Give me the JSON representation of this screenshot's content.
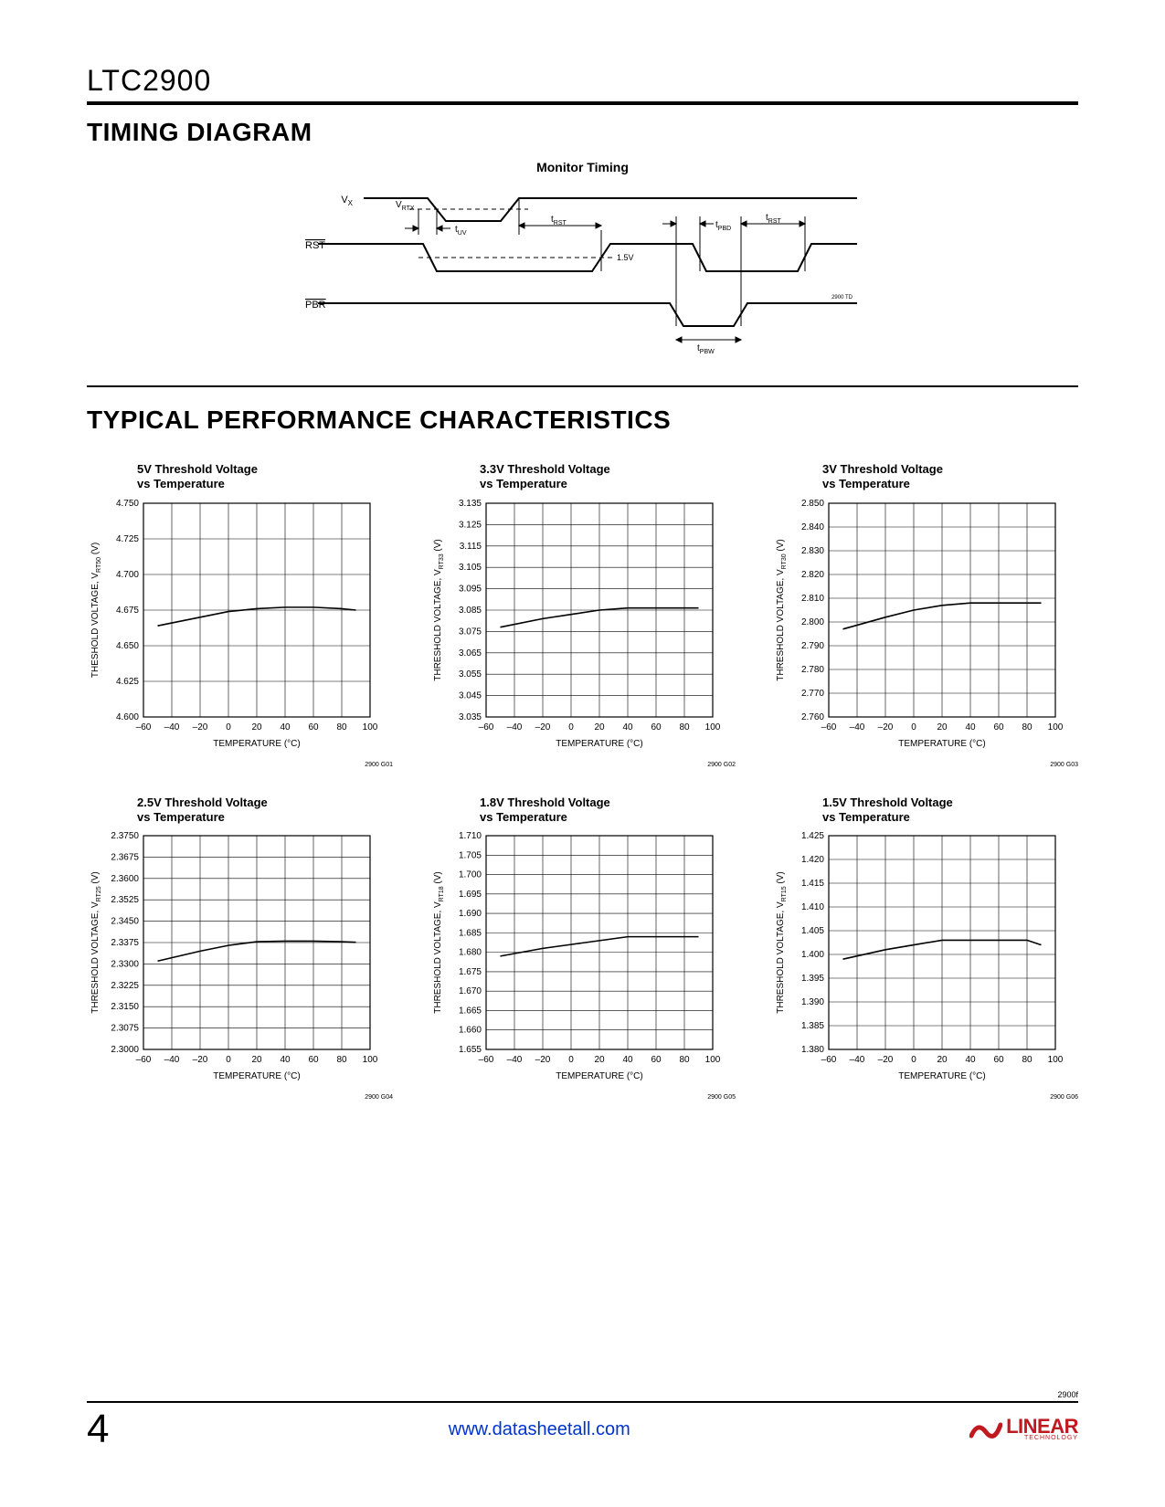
{
  "header": {
    "part_number": "LTC2900"
  },
  "sections": {
    "timing_heading": "TIMING DIAGRAM",
    "perf_heading": "TYPICAL PERFORMANCE CHARACTERISTICS"
  },
  "timing": {
    "title": "Monitor Timing",
    "signals": {
      "vx": "V",
      "vx_sub": "X",
      "rst": "RST",
      "pbr": "PBR"
    },
    "labels": {
      "vrtx": "V",
      "vrtx_sub": "RTX",
      "tuv": "t",
      "tuv_sub": "UV",
      "trst": "t",
      "trst_sub": "RST",
      "tpbd": "t",
      "tpbd_sub": "PBD",
      "trst2": "t",
      "trst2_sub": "RST",
      "tpbw": "t",
      "tpbw_sub": "PBW",
      "v15": "1.5V"
    },
    "code": "2900 TD"
  },
  "chart_data": [
    {
      "type": "line",
      "title": "5V Threshold Voltage\nvs Temperature",
      "xlabel": "TEMPERATURE (°C)",
      "ylabel": "THESHOLD VOLTAGE, V",
      "ylabel_sub": "RT50",
      "ylabel_unit": " (V)",
      "x": [
        -60,
        -40,
        -20,
        0,
        20,
        40,
        60,
        80,
        100
      ],
      "xlim": [
        -60,
        100
      ],
      "ylim": [
        4.6,
        4.75
      ],
      "yticks": [
        4.6,
        4.625,
        4.65,
        4.675,
        4.7,
        4.725,
        4.75
      ],
      "ytick_fmt": 3,
      "series": [
        {
          "name": "",
          "x": [
            -50,
            -20,
            0,
            20,
            40,
            60,
            80,
            90
          ],
          "values": [
            4.664,
            4.67,
            4.674,
            4.676,
            4.677,
            4.677,
            4.676,
            4.675
          ]
        }
      ],
      "code": "2900 G01"
    },
    {
      "type": "line",
      "title": "3.3V Threshold Voltage\nvs Temperature",
      "xlabel": "TEMPERATURE (°C)",
      "ylabel": "THRESHOLD VOLTAGE, V",
      "ylabel_sub": "RT33",
      "ylabel_unit": " (V)",
      "x": [
        -60,
        -40,
        -20,
        0,
        20,
        40,
        60,
        80,
        100
      ],
      "xlim": [
        -60,
        100
      ],
      "ylim": [
        3.035,
        3.135
      ],
      "yticks": [
        3.035,
        3.045,
        3.055,
        3.065,
        3.075,
        3.085,
        3.095,
        3.105,
        3.115,
        3.125,
        3.135
      ],
      "ytick_fmt": 3,
      "series": [
        {
          "name": "",
          "x": [
            -50,
            -20,
            0,
            20,
            40,
            60,
            80,
            90
          ],
          "values": [
            3.077,
            3.081,
            3.083,
            3.085,
            3.086,
            3.086,
            3.086,
            3.086
          ]
        }
      ],
      "code": "2900 G02"
    },
    {
      "type": "line",
      "title": "3V Threshold Voltage\nvs Temperature",
      "xlabel": "TEMPERATURE (°C)",
      "ylabel": "THRESHOLD VOLTAGE, V",
      "ylabel_sub": "RT30",
      "ylabel_unit": " (V)",
      "x": [
        -60,
        -40,
        -20,
        0,
        20,
        40,
        60,
        80,
        100
      ],
      "xlim": [
        -60,
        100
      ],
      "ylim": [
        2.76,
        2.85
      ],
      "yticks": [
        2.76,
        2.77,
        2.78,
        2.79,
        2.8,
        2.81,
        2.82,
        2.83,
        2.84,
        2.85
      ],
      "ytick_fmt": 3,
      "series": [
        {
          "name": "",
          "x": [
            -50,
            -20,
            0,
            20,
            40,
            60,
            80,
            90
          ],
          "values": [
            2.797,
            2.802,
            2.805,
            2.807,
            2.808,
            2.808,
            2.808,
            2.808
          ]
        }
      ],
      "code": "2900 G03"
    },
    {
      "type": "line",
      "title": "2.5V Threshold Voltage\nvs Temperature",
      "xlabel": "TEMPERATURE (°C)",
      "ylabel": "THRESHOLD VOLTAGE, V",
      "ylabel_sub": "RT25",
      "ylabel_unit": " (V)",
      "x": [
        -60,
        -40,
        -20,
        0,
        20,
        40,
        60,
        80,
        100
      ],
      "xlim": [
        -60,
        100
      ],
      "ylim": [
        2.3,
        2.375
      ],
      "yticks": [
        2.3,
        2.3075,
        2.315,
        2.3225,
        2.33,
        2.3375,
        2.345,
        2.3525,
        2.36,
        2.3675,
        2.375
      ],
      "ytick_fmt": 4,
      "series": [
        {
          "name": "",
          "x": [
            -50,
            -20,
            0,
            20,
            40,
            60,
            80,
            90
          ],
          "values": [
            2.331,
            2.3345,
            2.3365,
            2.3378,
            2.338,
            2.338,
            2.3378,
            2.3376
          ]
        }
      ],
      "code": "2900 G04"
    },
    {
      "type": "line",
      "title": "1.8V Threshold Voltage\nvs Temperature",
      "xlabel": "TEMPERATURE (°C)",
      "ylabel": "THRESHOLD VOLTAGE, V",
      "ylabel_sub": "RT18",
      "ylabel_unit": " (V)",
      "x": [
        -60,
        -40,
        -20,
        0,
        20,
        40,
        60,
        80,
        100
      ],
      "xlim": [
        -60,
        100
      ],
      "ylim": [
        1.655,
        1.71
      ],
      "yticks": [
        1.655,
        1.66,
        1.665,
        1.67,
        1.675,
        1.68,
        1.685,
        1.69,
        1.695,
        1.7,
        1.705,
        1.71
      ],
      "ytick_fmt": 3,
      "series": [
        {
          "name": "",
          "x": [
            -50,
            -20,
            0,
            20,
            40,
            60,
            80,
            90
          ],
          "values": [
            1.679,
            1.681,
            1.682,
            1.683,
            1.684,
            1.684,
            1.684,
            1.684
          ]
        }
      ],
      "code": "2900 G05"
    },
    {
      "type": "line",
      "title": "1.5V Threshold Voltage\nvs Temperature",
      "xlabel": "TEMPERATURE (°C)",
      "ylabel": "THRESHOLD VOLTAGE, V",
      "ylabel_sub": "RT15",
      "ylabel_unit": " (V)",
      "x": [
        -60,
        -40,
        -20,
        0,
        20,
        40,
        60,
        80,
        100
      ],
      "xlim": [
        -60,
        100
      ],
      "ylim": [
        1.38,
        1.425
      ],
      "yticks": [
        1.38,
        1.385,
        1.39,
        1.395,
        1.4,
        1.405,
        1.41,
        1.415,
        1.42,
        1.425
      ],
      "ytick_fmt": 3,
      "series": [
        {
          "name": "",
          "x": [
            -50,
            -20,
            0,
            20,
            40,
            60,
            80,
            90
          ],
          "values": [
            1.399,
            1.401,
            1.402,
            1.403,
            1.403,
            1.403,
            1.403,
            1.402
          ]
        }
      ],
      "code": "2900 G06"
    }
  ],
  "footer": {
    "doc_code": "2900f",
    "page_number": "4",
    "url": "www.datasheetall.com",
    "logo_main": "LINEAR",
    "logo_sub": "TECHNOLOGY"
  }
}
